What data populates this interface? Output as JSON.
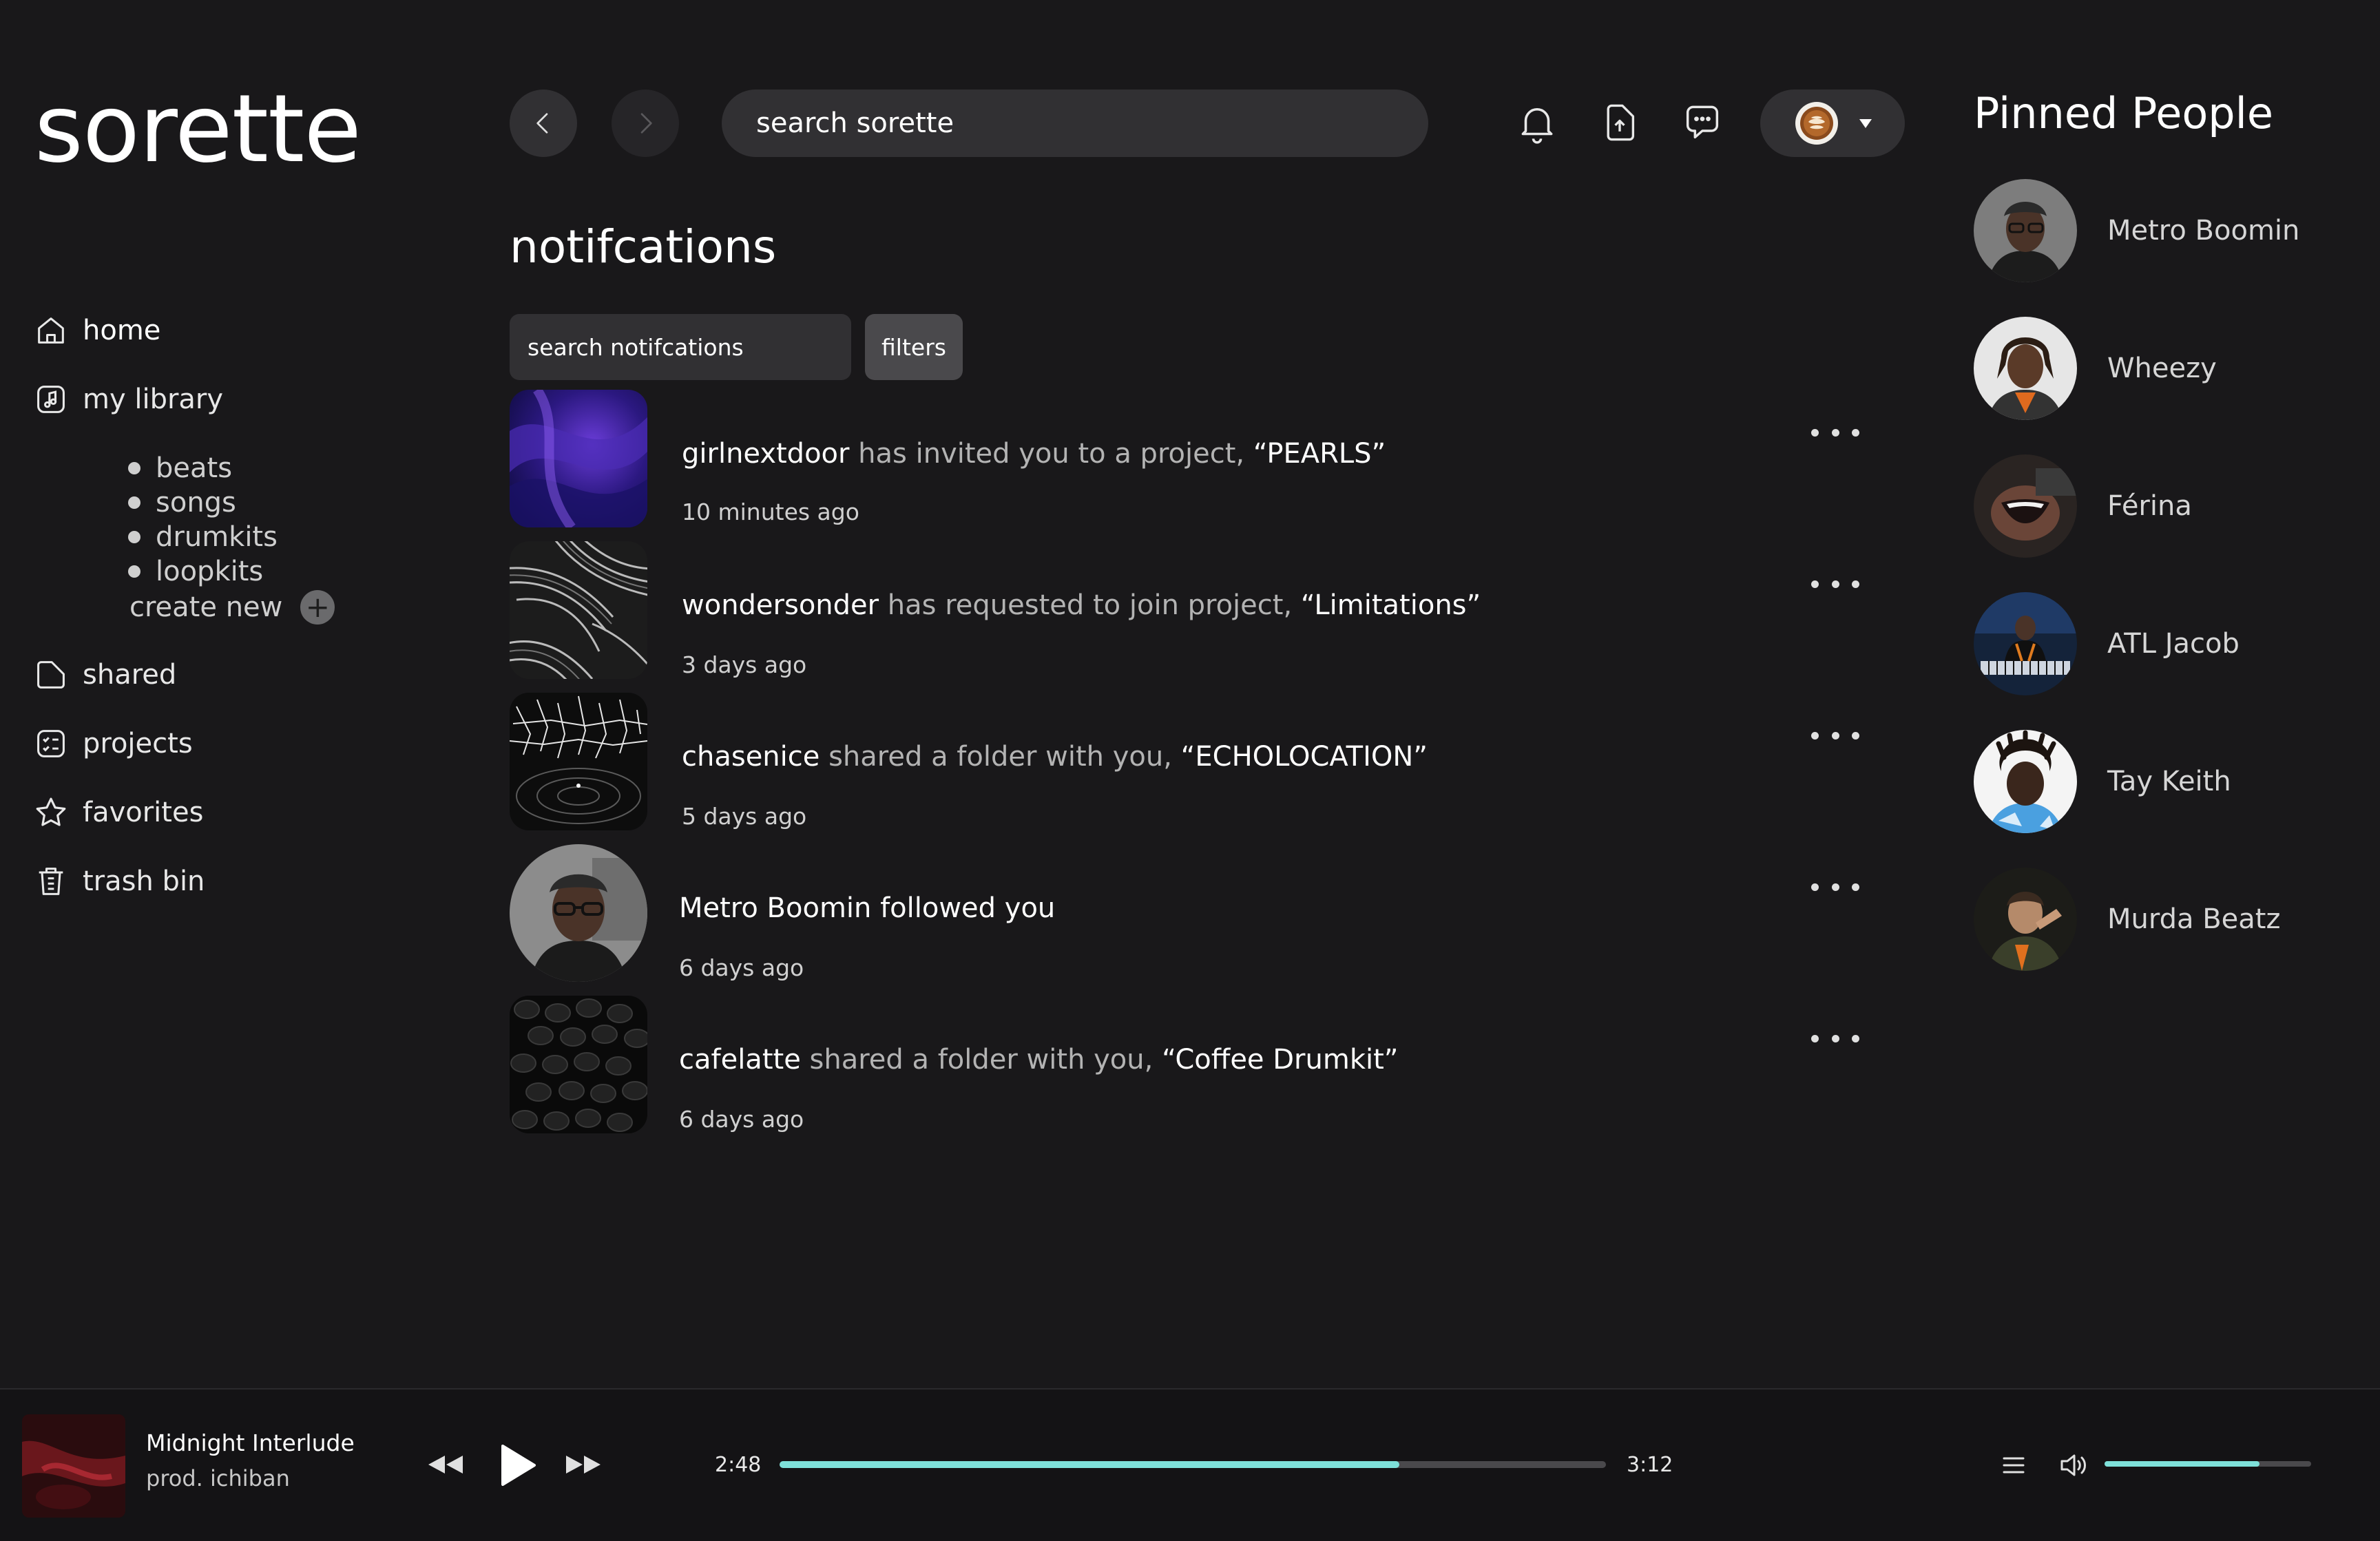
{
  "app": {
    "logo": "sorette"
  },
  "sidebar": {
    "items": [
      {
        "label": "home",
        "icon": "home-icon"
      },
      {
        "label": "my library",
        "icon": "music-note-icon"
      },
      {
        "label": "shared",
        "icon": "folder-icon"
      },
      {
        "label": "projects",
        "icon": "checklist-icon"
      },
      {
        "label": "favorites",
        "icon": "star-icon"
      },
      {
        "label": "trash bin",
        "icon": "trash-icon"
      }
    ],
    "library_sub": [
      "beats",
      "songs",
      "drumkits",
      "loopkits"
    ],
    "create_new": "create new"
  },
  "topbar": {
    "search_placeholder": "search sorette",
    "icons": [
      "chevron-left-icon",
      "chevron-right-icon",
      "bell-icon",
      "upload-icon",
      "message-icon",
      "latte-avatar-icon"
    ]
  },
  "main": {
    "title": "notifcations",
    "search_placeholder": "search notifcations",
    "filters_label": "filters",
    "notifications": [
      {
        "user": "girlnextdoor",
        "action": " has invited you to a project, ",
        "target": "“PEARLS”",
        "time": "10 minutes ago"
      },
      {
        "user": "wondersonder",
        "action": " has requested to join project, ",
        "target": "“Limitations”",
        "time": "3 days ago"
      },
      {
        "user": "chasenice",
        "action": " shared a folder with you, ",
        "target": "“ECHOLOCATION”",
        "time": "5 days ago"
      },
      {
        "user": "Metro Boomin followed you",
        "action": "",
        "target": "",
        "time": "6 days ago"
      },
      {
        "user": "cafelatte",
        "action": " shared a folder with you, ",
        "target": "“Coffee Drumkit”",
        "time": "6 days ago"
      }
    ]
  },
  "pinned": {
    "title": "Pinned People",
    "people": [
      "Metro Boomin",
      "Wheezy",
      "Férina",
      "ATL Jacob",
      "Tay Keith",
      "Murda Beatz"
    ]
  },
  "player": {
    "track_title": "Midnight Interlude",
    "artist": "prod. ichiban",
    "elapsed": "2:48",
    "duration": "3:12",
    "progress_fraction": 0.75,
    "volume_fraction": 0.75,
    "accent_color": "#7ee0d9"
  }
}
